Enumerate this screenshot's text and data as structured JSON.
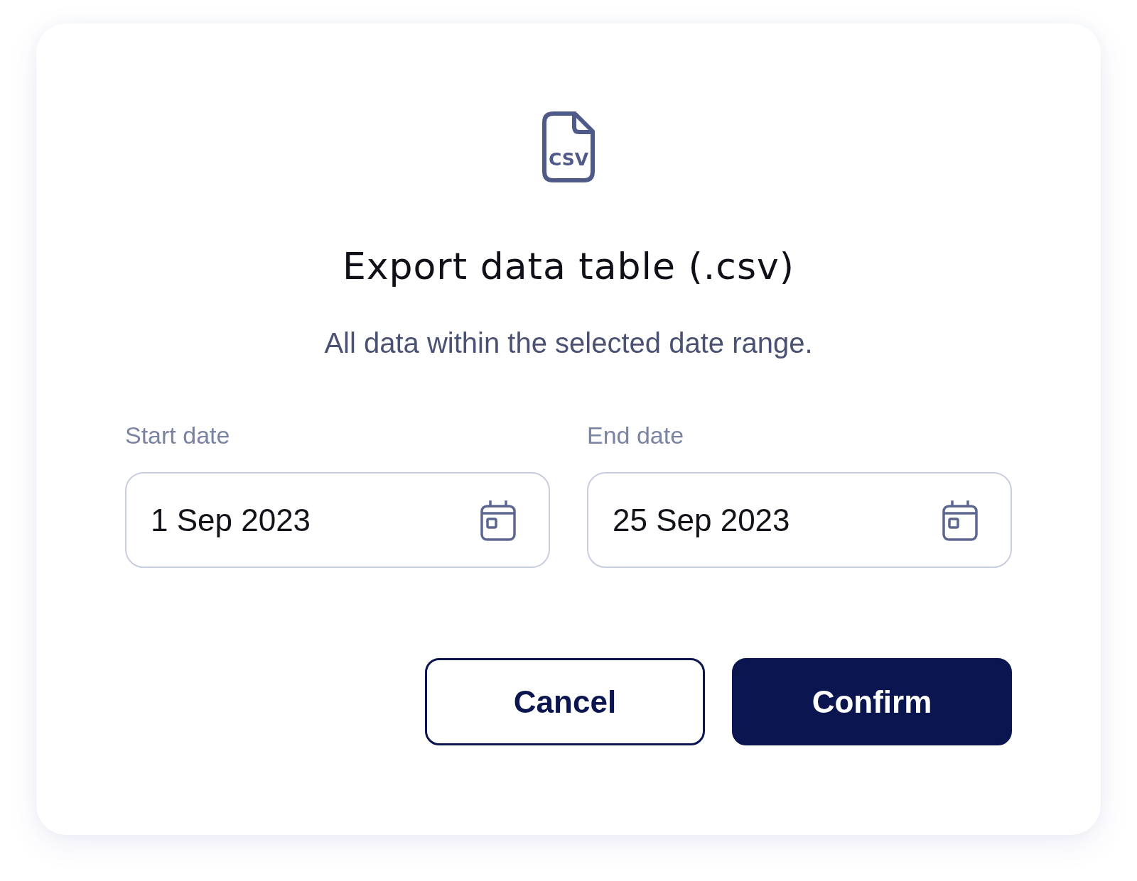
{
  "dialog": {
    "icon_label": "CSV",
    "title": "Export data table (.csv)",
    "description": "All data within the selected date range.",
    "fields": [
      {
        "label": "Start date",
        "value": "1 Sep 2023"
      },
      {
        "label": "End date",
        "value": "25 Sep 2023"
      }
    ],
    "buttons": [
      {
        "label": "Cancel",
        "kind": "secondary"
      },
      {
        "label": "Confirm",
        "kind": "primary"
      }
    ]
  }
}
